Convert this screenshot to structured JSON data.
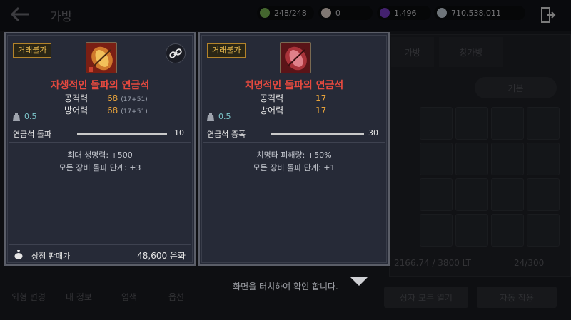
{
  "header": {
    "title": "가방",
    "currencies": [
      {
        "value": "248/248",
        "icon": "energy-icon",
        "color": "#7dbb55"
      },
      {
        "value": "0",
        "icon": "pearl-icon",
        "color": "#e8d9d0"
      },
      {
        "value": "1,496",
        "icon": "gem-icon",
        "color": "#7a3cc8"
      },
      {
        "value": "710,538,011",
        "icon": "silver-coin-icon",
        "color": "#c9d3dc"
      }
    ]
  },
  "background": {
    "tabs": [
      "가방",
      "창가방"
    ],
    "sort_button": "기본",
    "weight_text": "2166.74 / 3800 LT",
    "slot_count": "24/300",
    "bottom_left_tabs": [
      "외형 변경",
      "내 정보",
      "염색",
      "옵션"
    ],
    "open_all_button": "상자 모두 열기",
    "auto_use_button": "자동 착용"
  },
  "tooltips": [
    {
      "badge": "거래불가",
      "name": "자생적인 돌파의 연금석",
      "icon": "orange-alchemy-stone-icon",
      "has_link": true,
      "stats": [
        {
          "label": "공격력",
          "value": "68",
          "detail": "(17+51)"
        },
        {
          "label": "방어력",
          "value": "68",
          "detail": "(17+51)"
        }
      ],
      "weight": "0.5",
      "stone_label": "연금석 돌파",
      "stone_value": "10",
      "effects": [
        "최대 생명력: +500",
        "모든 장비 돌파 단계: +3"
      ],
      "sell_label": "상점 판매가",
      "sell_value": "48,600 은화"
    },
    {
      "badge": "거래불가",
      "name": "치명적인 돌파의 연금석",
      "icon": "red-alchemy-stone-icon",
      "has_link": false,
      "stats": [
        {
          "label": "공격력",
          "value": "17",
          "detail": ""
        },
        {
          "label": "방어력",
          "value": "17",
          "detail": ""
        }
      ],
      "weight": "0.5",
      "stone_label": "연금석 증폭",
      "stone_value": "30",
      "effects": [
        "치명타 피해량: +50%",
        "모든 장비 돌파 단계: +1"
      ]
    }
  ],
  "touch_hint": "화면을 터치하여 확인 합니다."
}
